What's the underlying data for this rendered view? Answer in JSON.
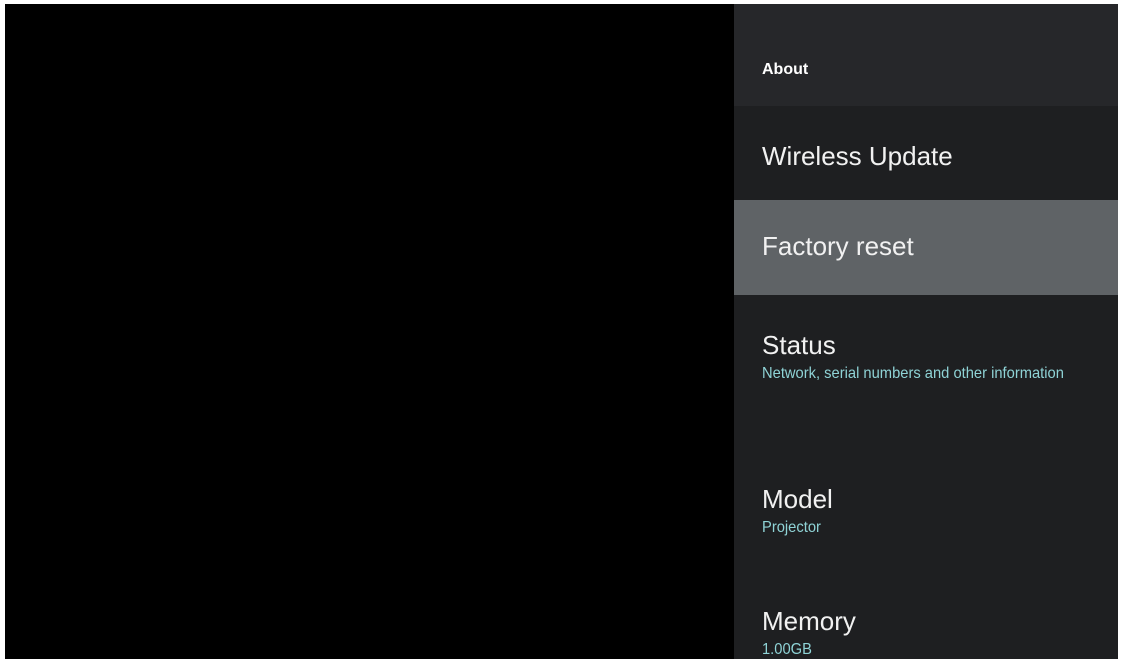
{
  "settings_panel": {
    "title": "About",
    "items": [
      {
        "title": "Wireless Update",
        "summary": "",
        "focused": false
      },
      {
        "title": "Factory reset",
        "summary": "",
        "focused": true
      },
      {
        "title": "Status",
        "summary": "Network, serial numbers and other information",
        "focused": false
      },
      {
        "title": "Model",
        "summary": "Projector",
        "focused": false
      },
      {
        "title": "Memory",
        "summary": "1.00GB",
        "focused": false
      }
    ]
  },
  "colors": {
    "panel_background": "#1e1f21",
    "header_background": "#26272a",
    "focused_background": "#5f6366",
    "summary_text": "#8fd3d6",
    "title_text": "#f1f1f1"
  }
}
